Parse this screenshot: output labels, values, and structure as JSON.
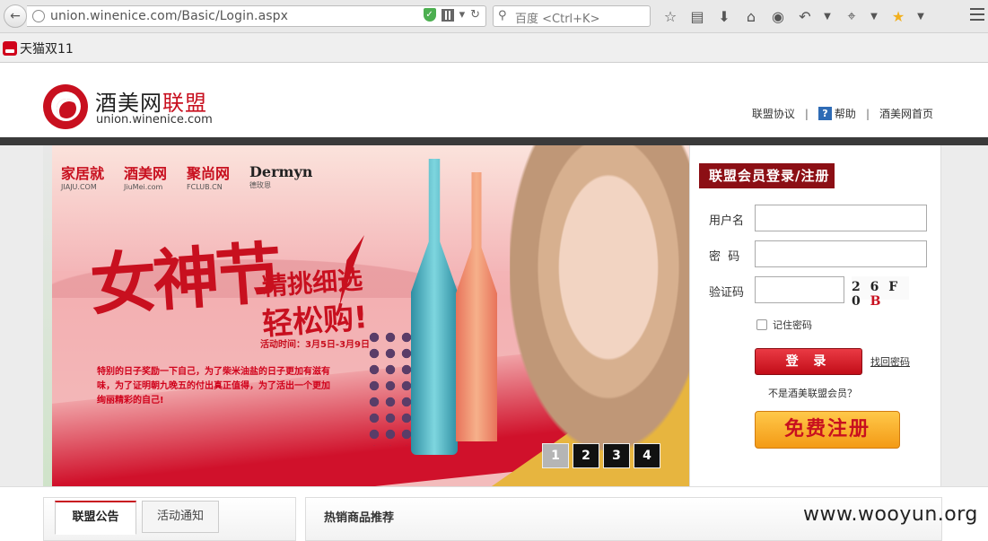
{
  "browser": {
    "url": "union.winenice.com/Basic/Login.aspx",
    "search_placeholder": "百度 <Ctrl+K>",
    "bookmarks": [
      {
        "label": "天猫双11"
      }
    ]
  },
  "header": {
    "logo_main": "酒美网",
    "logo_red": "联盟",
    "logo_url": "union.winenice.com",
    "links": [
      "联盟协议",
      "帮助",
      "酒美网首页"
    ]
  },
  "banner": {
    "brands": [
      {
        "name": "家居就",
        "sub": "JIAJU.COM"
      },
      {
        "name": "酒美网",
        "sub": "JiuMei.com"
      },
      {
        "name": "聚尚网",
        "sub": "FCLUB.CN"
      },
      {
        "name": "Dermyn",
        "sub": "德玫恩"
      }
    ],
    "headline": "女神节",
    "subline1": "精挑细选",
    "subline2": "轻松购!",
    "event_time": "活动时间：3月5日-3月9日",
    "promo": "特别的日子奖励一下自己，为了柴米油盐的日子更加有滋有味，为了证明朝九晚五的付出真正值得，为了活出一个更加绚丽精彩的自己!",
    "pages": [
      "1",
      "2",
      "3",
      "4"
    ],
    "active_page": "1"
  },
  "login": {
    "title": "联盟会员登录/注册",
    "username_label": "用户名",
    "password_label": "密  码",
    "captcha_label": "验证码",
    "captcha_text": "2 6 F 0",
    "captcha_red": "B",
    "remember_label": "记住密码",
    "login_button": "登 录",
    "forgot_link": "找回密码",
    "not_member": "不是酒美联盟会员？",
    "register_button": "免费注册"
  },
  "lower": {
    "tabs": [
      "联盟公告",
      "活动通知"
    ],
    "hot_title": "热销商品推荐"
  },
  "watermark": "www.wooyun.org"
}
